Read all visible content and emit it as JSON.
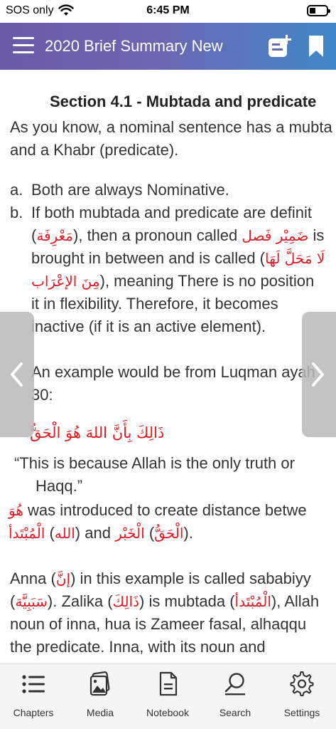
{
  "status_bar": {
    "carrier": "SOS only",
    "time": "6:45 PM"
  },
  "header": {
    "title": "2020 Brief Summary New"
  },
  "section_title": "Section 4.1 - Mubtada and predicate",
  "intro": [
    "As you know, a nominal sentence has a mubta",
    "and a Khabr (predicate)."
  ],
  "list": {
    "a": {
      "marker": "a.",
      "text": "Both are always Nominative."
    },
    "b": {
      "marker": "b.",
      "line1": "If both mubtada and predicate are definit",
      "line2_open": "(",
      "line2_ar1": "مَعْرِفَة",
      "line2_mid": "), then a pronoun called ",
      "line2_ar2": "ضَمِيْر فَصل",
      "line2_end": " is",
      "line3": "brought in between and is called (",
      "line3_ar": "لَا مَحَلَّ لَهَا",
      "line4_ar": "مِنَ الإعْرَاب",
      "line4_text": "), meaning There is no position",
      "line5": "it in flexibility. Therefore, it becomes",
      "line6": "inactive (if it is an active element)."
    }
  },
  "example_intro": [
    "An example would be from Luqman ayah",
    "30:"
  ],
  "verse_arabic": "ذَالِكَ بِأَنَّ اللهَ هُوَ الْحَقُّ",
  "translation": [
    "“This is because Allah is the only truth or",
    "Haqq.”"
  ],
  "hua_line": {
    "ar": "هُوَ",
    "text": " was introduced to create distance betwe",
    "ar2": "الْمُبْتَدأ",
    "open2": " (",
    "ar3": "الله",
    "close_and": ") and ",
    "ar4": "الْخَبْر",
    "open4": " (",
    "ar5": "الْحَقُّ",
    "close": ")."
  },
  "paragraph": {
    "p1_a": "Anna (",
    "p1_ar": "إنَّ",
    "p1_b": ") in this example is called sababiyy",
    "p2_open": "(",
    "p2_ar1": "سَبَبِيَّة",
    "p2_b": "). Zalika (",
    "p2_ar2": "ذَالِكَ",
    "p2_c": ") is mubtada (",
    "p2_ar3": "الْمُبْتَدأ",
    "p2_d": "), Allah",
    "p3": "noun of inna, hua is Zameer fasal, alhaqqu",
    "p4": "the predicate. Inna, with its noun and"
  },
  "tabs": [
    {
      "label": "Chapters",
      "icon": "list-icon"
    },
    {
      "label": "Media",
      "icon": "media-icon"
    },
    {
      "label": "Notebook",
      "icon": "notebook-icon"
    },
    {
      "label": "Search",
      "icon": "search-icon"
    },
    {
      "label": "Settings",
      "icon": "gear-icon"
    }
  ],
  "colors": {
    "arabic": "#e01b24",
    "header_start": "#6a5aa8",
    "header_end": "#3f87c8"
  }
}
